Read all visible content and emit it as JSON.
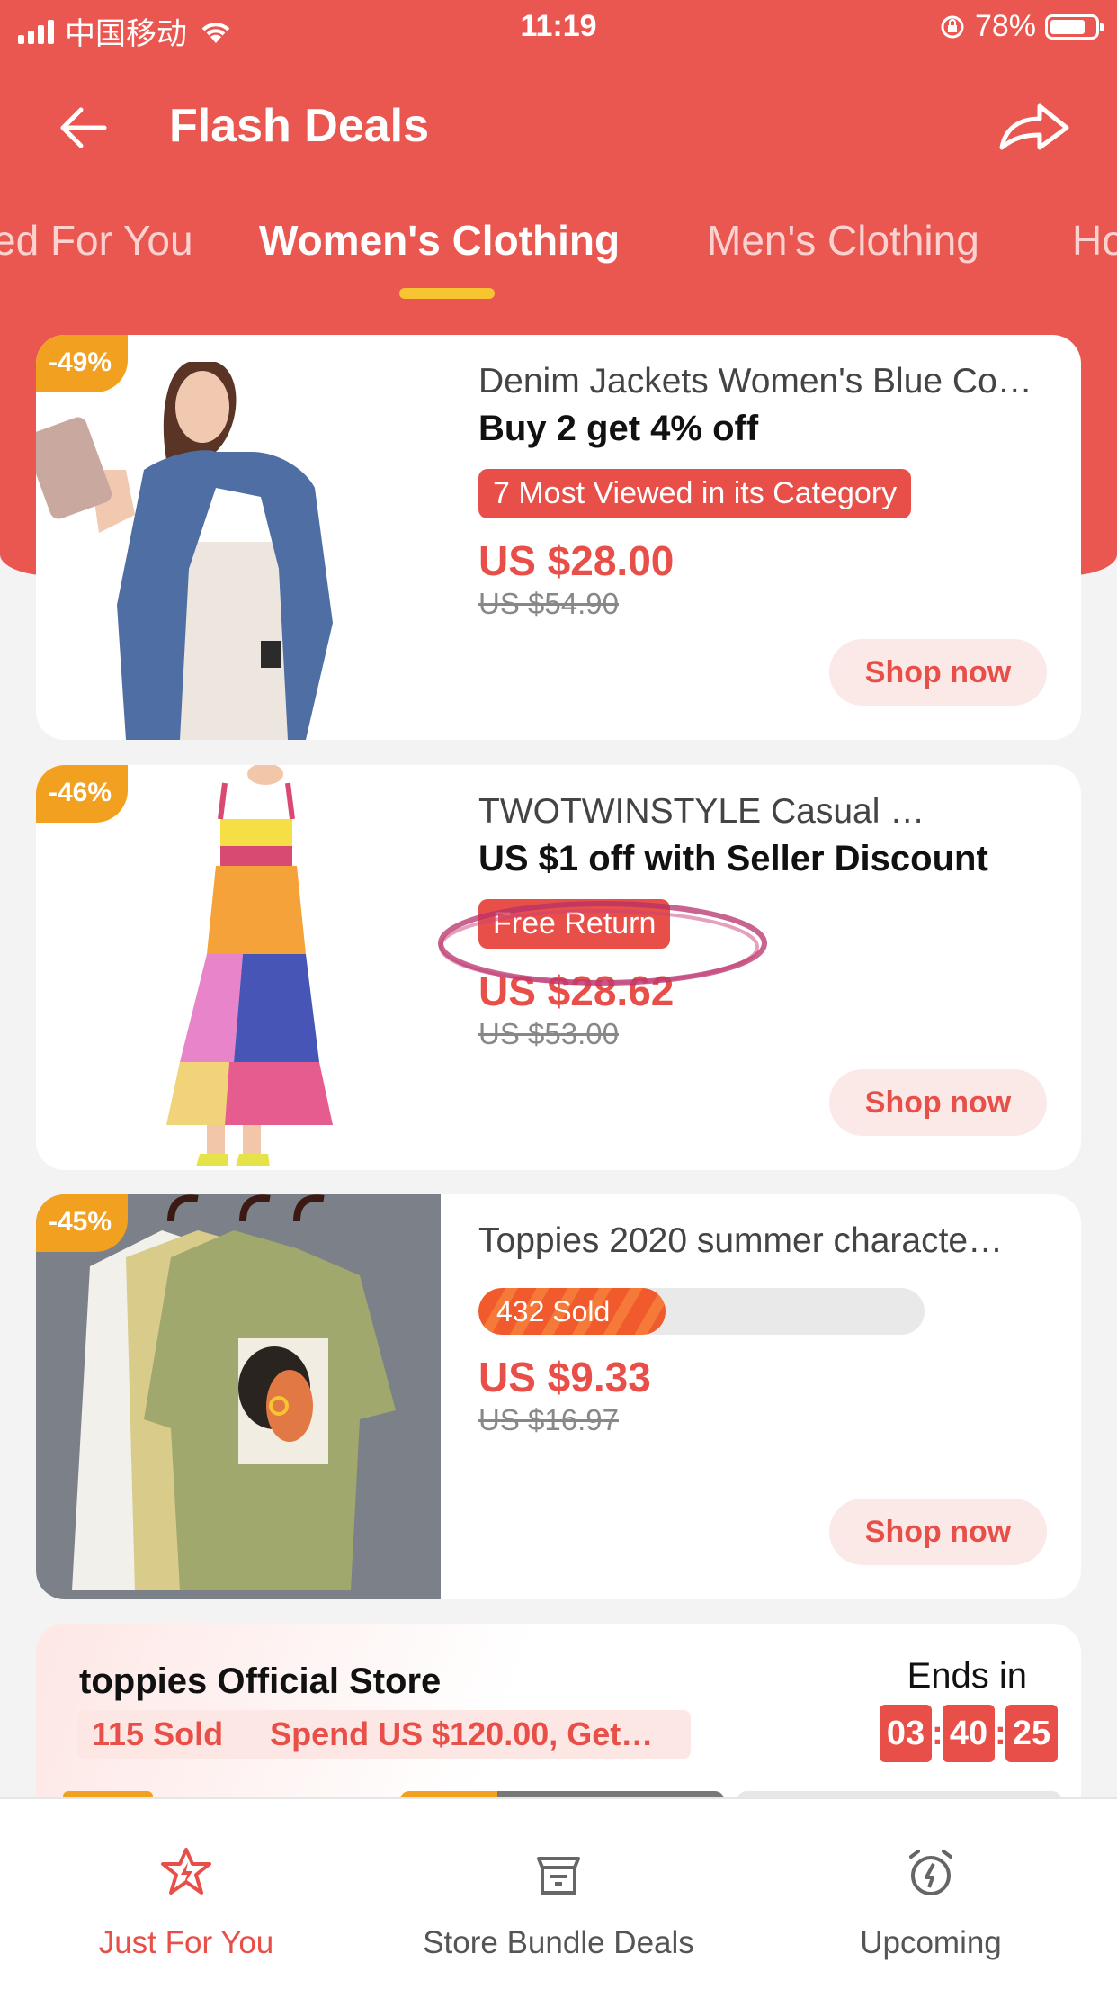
{
  "status_bar": {
    "carrier": "中国移动",
    "time": "11:19",
    "battery": "78%",
    "battery_level": 0.78
  },
  "header": {
    "title": "Flash Deals"
  },
  "tabs": [
    {
      "label": "ed For You",
      "active": false
    },
    {
      "label": "Women's Clothing",
      "active": true
    },
    {
      "label": "Men's Clothing",
      "active": false
    },
    {
      "label": "Ho",
      "active": false
    }
  ],
  "products": [
    {
      "discount": "-49%",
      "title": "Denim Jackets Women's Blue Co…",
      "promo": "Buy 2 get 4% off",
      "tag": "7 Most Viewed in its Category",
      "price": "US $28.00",
      "original_price": "US $54.90",
      "button": "Shop now"
    },
    {
      "discount": "-46%",
      "title": "TWOTWINSTYLE Casual …",
      "promo": "US $1 off with Seller Discount",
      "tag": "Free Return",
      "price": "US $28.62",
      "original_price": "US $53.00",
      "button": "Shop now"
    },
    {
      "discount": "-45%",
      "title": "Toppies 2020 summer characte…",
      "sold": "432 Sold",
      "sold_progress": 0.42,
      "price": "US $9.33",
      "original_price": "US $16.97",
      "button": "Shop now"
    }
  ],
  "store": {
    "name": "toppies Official Store",
    "sold": "115 Sold",
    "offer": "Spend US $120.00, Get…",
    "ends_label": "Ends in",
    "timer": {
      "hours": "03",
      "minutes": "40",
      "seconds": "25"
    }
  },
  "bottom_nav": [
    {
      "label": "Just For You",
      "icon": "flash-star-icon",
      "active": true
    },
    {
      "label": "Store Bundle Deals",
      "icon": "bundle-box-icon",
      "active": false
    },
    {
      "label": "Upcoming",
      "icon": "alarm-clock-icon",
      "active": false
    }
  ],
  "colors": {
    "accent": "#ea5650",
    "badge": "#f2a020",
    "tab_underline": "#f7c531"
  }
}
